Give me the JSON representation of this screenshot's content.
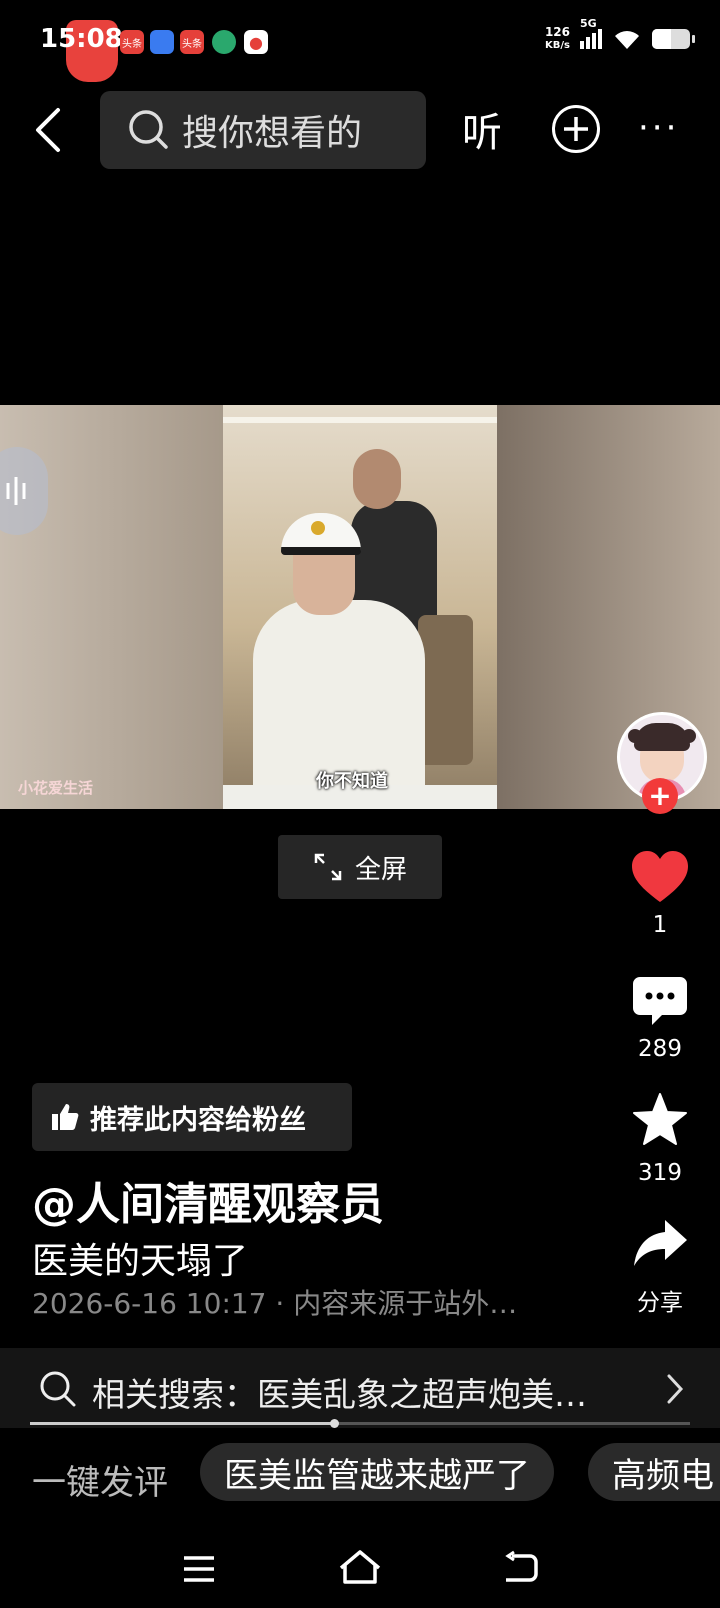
{
  "status_bar": {
    "time": "15:08",
    "net_speed_value": "126",
    "net_speed_unit": "KB/s",
    "network": "5G",
    "notification_apps": [
      "toutiao-icon",
      "docs-icon",
      "toutiao-icon",
      "app-icon",
      "map-pin-icon"
    ],
    "notification_labels": [
      "头条",
      "",
      "头条",
      "",
      ""
    ]
  },
  "top_bar": {
    "search_placeholder": "搜你想看的",
    "listen_label": "听"
  },
  "video": {
    "watermark": "小花爱生活",
    "subtitle": "你不知道",
    "fullscreen_label": "全屏"
  },
  "actions": {
    "like_count": "1",
    "comment_count": "289",
    "favorite_count": "319",
    "share_label": "分享",
    "follow_symbol": "+"
  },
  "post": {
    "recommend_label": "推荐此内容给粉丝",
    "author": "@人间清醒观察员",
    "description": "医美的天塌了",
    "meta": "2026-6-16 10:17 · 内容来源于站外…"
  },
  "related": {
    "text": "相关搜索：医美乱象之超声炮美…"
  },
  "progress": {
    "played_fraction": 0.46
  },
  "quick_comment": {
    "label": "一键发评",
    "chips": [
      "医美监管越来越严了",
      "高频电"
    ]
  },
  "colors": {
    "like": "#f0383f",
    "follow_badge": "#f23a3a"
  }
}
